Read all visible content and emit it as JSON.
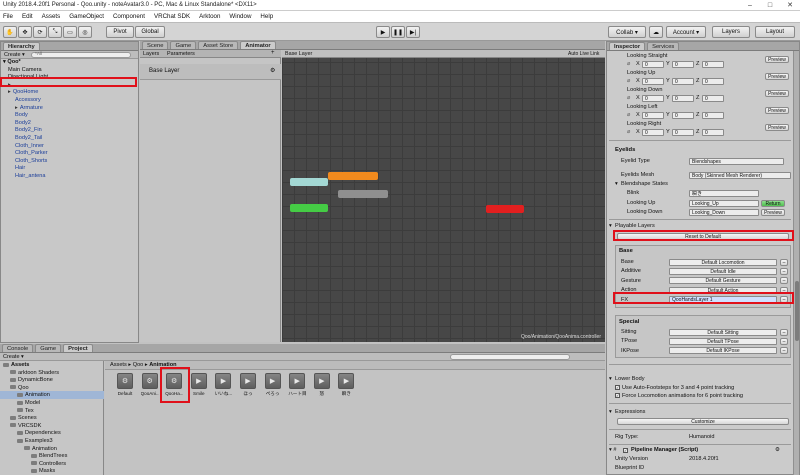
{
  "window": {
    "title": "Unity 2018.4.20f1 Personal - Qoo.unity - noteAvatar3.0 - PC, Mac & Linux Standalone* <DX11>"
  },
  "menu": [
    "File",
    "Edit",
    "Assets",
    "GameObject",
    "Component",
    "VRChat SDK",
    "Arktoon",
    "Window",
    "Help"
  ],
  "toolbar": {
    "pivot": "Pivot",
    "global": "Global",
    "collab": "Collab ▾",
    "account": "Account ▾",
    "layers": "Layers",
    "layout": "Layout"
  },
  "hierarchy": {
    "tab": "Hierarchy",
    "create": "Create ▾",
    "search": "*All",
    "scene": "Qoo*",
    "rows": [
      {
        "t": "Main Camera",
        "blue": false,
        "d": 1
      },
      {
        "t": "Directional Light",
        "blue": false,
        "d": 1
      },
      {
        "t": "",
        "blue": true,
        "d": 1
      },
      {
        "t": "QooHome",
        "blue": true,
        "d": 1
      },
      {
        "t": "Accessory",
        "blue": true,
        "d": 2
      },
      {
        "t": "Armature",
        "blue": true,
        "d": 2
      },
      {
        "t": "Body",
        "blue": true,
        "d": 2
      },
      {
        "t": "Body2",
        "blue": true,
        "d": 2
      },
      {
        "t": "Body2_Fin",
        "blue": true,
        "d": 2
      },
      {
        "t": "Body2_Tail",
        "blue": true,
        "d": 2
      },
      {
        "t": "Cloth_Inner",
        "blue": true,
        "d": 2
      },
      {
        "t": "Cloth_Parker",
        "blue": true,
        "d": 2
      },
      {
        "t": "Cloth_Shorts",
        "blue": true,
        "d": 2
      },
      {
        "t": "Hair",
        "blue": true,
        "d": 2
      },
      {
        "t": "Hair_antena",
        "blue": true,
        "d": 2
      }
    ]
  },
  "centerTabs": [
    "Scene",
    "Game",
    "Asset Store",
    "Animator"
  ],
  "animator": {
    "layers_tab": "Layers",
    "params_tab": "Parameters",
    "layer": "Base Layer",
    "breadcrumb": "Base Layer",
    "autolive": "Auto Live Link",
    "path": "Qoo/Animation/QooAnima.controller"
  },
  "inspector": {
    "tabs": [
      "Inspector",
      "Services"
    ],
    "looking": [
      {
        "label": "Looking Straight",
        "btn": "Preview"
      },
      {
        "label": "Looking Up",
        "btn": "Preview"
      },
      {
        "label": "Looking Down",
        "btn": "Preview"
      },
      {
        "label": "Looking Left",
        "btn": "Preview"
      },
      {
        "label": "Looking Right",
        "btn": "Preview"
      }
    ],
    "xyz": [
      "X",
      "0",
      "Y",
      "0",
      "Z",
      "0"
    ],
    "eyelids": {
      "title": "Eyelids",
      "type_label": "Eyelid Type",
      "type_val": "Blendshapes",
      "mesh_label": "Eyelids Mesh",
      "mesh_val": "Body (Skinned Mesh Renderer)",
      "states": "Blendshape States",
      "blink": "Blink",
      "blink_val": "瞬き",
      "up": "Looking Up",
      "up_val": "Looking_Up",
      "down": "Looking Down",
      "down_val": "Looking_Down",
      "return": "Return",
      "preview": "Preview"
    },
    "playable": "Playable Layers",
    "reset": "Reset to Default",
    "base": {
      "title": "Base",
      "rows": [
        {
          "label": "Base",
          "val": "Default Locomotion"
        },
        {
          "label": "Additive",
          "val": "Default Idle"
        },
        {
          "label": "Gesture",
          "val": "Default Gesture"
        },
        {
          "label": "Action",
          "val": "Default Action"
        },
        {
          "label": "FX",
          "val": "QooHandsLayer 1"
        }
      ]
    },
    "special": {
      "title": "Special",
      "rows": [
        {
          "label": "Sitting",
          "val": "Default Sitting"
        },
        {
          "label": "TPose",
          "val": "Default TPose"
        },
        {
          "label": "IKPose",
          "val": "Default IKPose"
        }
      ]
    },
    "lowerbody": {
      "title": "Lower Body",
      "c1": "Use Auto-Footsteps for 3 and 4 point tracking",
      "c2": "Force Locomotion animations for 6 point tracking"
    },
    "expressions": {
      "title": "Expressions",
      "btn": "Customize"
    },
    "rig": {
      "label": "Rig Type:",
      "val": "Humanoid"
    },
    "pipeline": {
      "title": "Pipeline Manager (Script)",
      "unity_label": "Unity Version",
      "unity_val": "2018.4.20f1",
      "bp": "Blueprint ID"
    }
  },
  "bottomTabs": [
    "Console",
    "Game",
    "Project"
  ],
  "project": {
    "create": "Create ▾",
    "tree": [
      {
        "t": "Assets",
        "d": 0,
        "bold": true
      },
      {
        "t": "arktoon Shaders",
        "d": 1
      },
      {
        "t": "DynamicBone",
        "d": 1
      },
      {
        "t": "Qoo",
        "d": 1
      },
      {
        "t": "Animation",
        "d": 2,
        "sel": true
      },
      {
        "t": "Model",
        "d": 2
      },
      {
        "t": "Tex",
        "d": 2
      },
      {
        "t": "Scenes",
        "d": 1
      },
      {
        "t": "VRCSDK",
        "d": 1
      },
      {
        "t": "Dependencies",
        "d": 2
      },
      {
        "t": "Examples3",
        "d": 2
      },
      {
        "t": "Animation",
        "d": 3
      },
      {
        "t": "BlendTrees",
        "d": 4
      },
      {
        "t": "Controllers",
        "d": 4
      },
      {
        "t": "Masks",
        "d": 4
      }
    ],
    "breadcrumb": [
      "Assets",
      "Qoo",
      "Animation"
    ],
    "assets": [
      "Default",
      "QooAni...",
      "QooHa...",
      "Smile",
      "いいね...",
      "ほっ",
      "ぺろっ",
      "ハート目",
      "怒",
      "瞬き"
    ]
  }
}
